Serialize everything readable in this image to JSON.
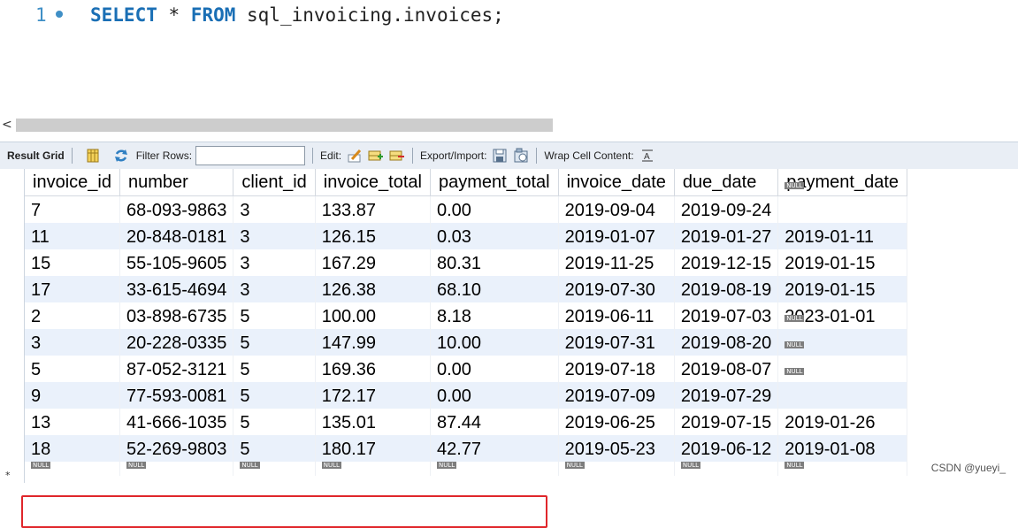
{
  "editor": {
    "line_number": "1",
    "keyword_select": "SELECT",
    "star": " * ",
    "keyword_from": "FROM",
    "table_ref": " sql_invoicing.invoices;"
  },
  "scrollbar": {
    "left_arrow": "<"
  },
  "toolbar": {
    "result_grid": "Result Grid",
    "filter_rows": "Filter Rows:",
    "filter_value": "",
    "edit": "Edit:",
    "export_import": "Export/Import:",
    "wrap_cell": "Wrap Cell Content:"
  },
  "grid": {
    "columns": [
      "invoice_id",
      "number",
      "client_id",
      "invoice_total",
      "payment_total",
      "invoice_date",
      "due_date",
      "payment_date"
    ],
    "null_label": "NULL",
    "rows": [
      [
        "7",
        "68-093-9863",
        "3",
        "133.87",
        "0.00",
        "2019-09-04",
        "2019-09-24",
        null
      ],
      [
        "11",
        "20-848-0181",
        "3",
        "126.15",
        "0.03",
        "2019-01-07",
        "2019-01-27",
        "2019-01-11"
      ],
      [
        "15",
        "55-105-9605",
        "3",
        "167.29",
        "80.31",
        "2019-11-25",
        "2019-12-15",
        "2019-01-15"
      ],
      [
        "17",
        "33-615-4694",
        "3",
        "126.38",
        "68.10",
        "2019-07-30",
        "2019-08-19",
        "2019-01-15"
      ],
      [
        "2",
        "03-898-6735",
        "5",
        "100.00",
        "8.18",
        "2019-06-11",
        "2019-07-03",
        "2023-01-01"
      ],
      [
        "3",
        "20-228-0335",
        "5",
        "147.99",
        "10.00",
        "2019-07-31",
        "2019-08-20",
        null
      ],
      [
        "5",
        "87-052-3121",
        "5",
        "169.36",
        "0.00",
        "2019-07-18",
        "2019-08-07",
        null
      ],
      [
        "9",
        "77-593-0081",
        "5",
        "172.17",
        "0.00",
        "2019-07-09",
        "2019-07-29",
        null
      ],
      [
        "13",
        "41-666-1035",
        "5",
        "135.01",
        "87.44",
        "2019-06-25",
        "2019-07-15",
        "2019-01-26"
      ],
      [
        "18",
        "52-269-9803",
        "5",
        "180.17",
        "42.77",
        "2019-05-23",
        "2019-06-12",
        "2019-01-08"
      ]
    ],
    "new_row_marker": "*",
    "highlighted_row_index": 5
  },
  "watermark": "CSDN @yueyi_",
  "colors": {
    "highlight_border": "#e0262b",
    "keyword": "#1a6fb5",
    "alt_row": "#eaf1fb"
  }
}
